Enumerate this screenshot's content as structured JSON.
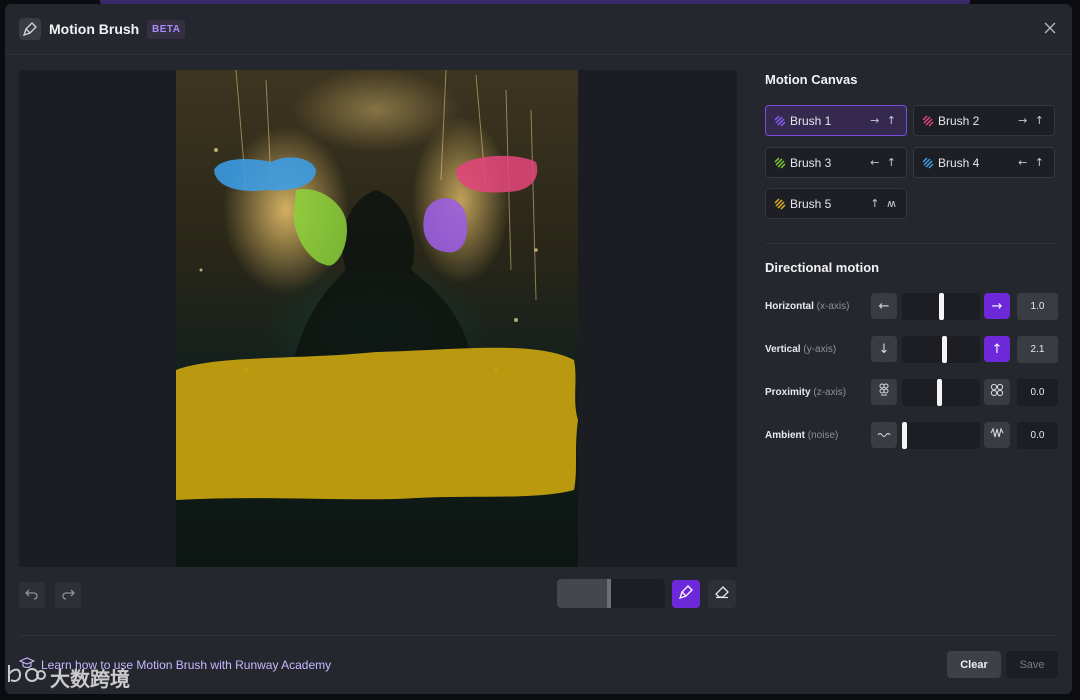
{
  "header": {
    "title": "Motion Brush",
    "badge": "BETA"
  },
  "canvas": {
    "undo_icon": "undo-icon",
    "redo_icon": "redo-icon",
    "brush_size_level": 0.46,
    "tools": [
      "brush-icon",
      "eraser-icon"
    ]
  },
  "motion_canvas": {
    "title": "Motion Canvas",
    "brushes": [
      {
        "label": "Brush 1",
        "arrows": "→ ↑",
        "color": "#7c3aed",
        "active": true
      },
      {
        "label": "Brush 2",
        "arrows": "→ ↑",
        "color": "#e0457b",
        "active": false
      },
      {
        "label": "Brush 3",
        "arrows": "← ↑",
        "color": "#7fc93a",
        "active": false
      },
      {
        "label": "Brush 4",
        "arrows": "← ↑",
        "color": "#3b9ee8",
        "active": false
      },
      {
        "label": "Brush 5",
        "arrows": "↑ ʍ",
        "color": "#e5b120",
        "active": false
      }
    ]
  },
  "directional_motion": {
    "title": "Directional motion",
    "rows": [
      {
        "label": "Horizontal",
        "sub": "(x-axis)",
        "left_icon": "arrow-left-icon",
        "right_icon": "arrow-right-icon",
        "value": "1.0",
        "level": 0.5,
        "right_active": true
      },
      {
        "label": "Vertical",
        "sub": "(y-axis)",
        "left_icon": "arrow-down-icon",
        "right_icon": "arrow-up-icon",
        "value": "2.1",
        "level": 0.55,
        "right_active": true
      },
      {
        "label": "Proximity",
        "sub": "(z-axis)",
        "left_icon": "cluster-small-icon",
        "right_icon": "cluster-large-icon",
        "value": "0.0",
        "level": 0.48,
        "right_active": false
      },
      {
        "label": "Ambient",
        "sub": "(noise)",
        "left_icon": "wave-low-icon",
        "right_icon": "wave-high-icon",
        "value": "0.0",
        "level": 0.0,
        "right_active": false
      }
    ]
  },
  "footer": {
    "learn_link": "Learn how to use Motion Brush with Runway Academy",
    "clear_label": "Clear",
    "save_label": "Save"
  },
  "watermark": {
    "text": "大数跨境"
  },
  "colors": {
    "accent": "#6d28d9",
    "blob_blue": "#3b9ee8",
    "blob_green": "#8bd13a",
    "blob_pink": "#e0457b",
    "blob_purple": "#9b5de5",
    "blob_yellow": "#c9a40f"
  }
}
